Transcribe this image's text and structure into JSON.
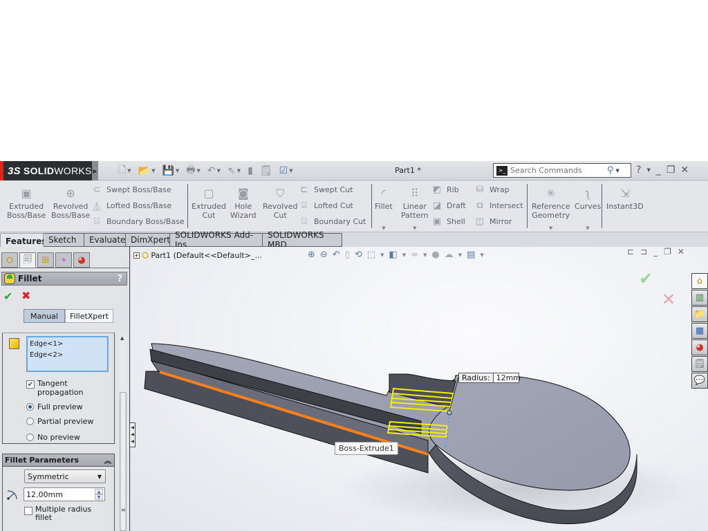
{
  "app": {
    "brand": "SOLIDWORKS",
    "brand_prefix": "3S",
    "brand_solid": "SOLID",
    "brand_works": "WORKS",
    "document_title": "Part1 *",
    "accent_color": "#d9261c"
  },
  "quick_access": [
    {
      "icon": "new-document-icon",
      "glyph": "🗋"
    },
    {
      "icon": "open-folder-icon",
      "glyph": "📂"
    },
    {
      "icon": "save-icon",
      "glyph": "💾"
    },
    {
      "icon": "print-icon",
      "glyph": "🖶"
    },
    {
      "icon": "undo-icon",
      "glyph": "↶"
    },
    {
      "icon": "select-pointer-icon",
      "glyph": "⇖"
    },
    {
      "icon": "rebuild-icon",
      "glyph": "▮"
    },
    {
      "icon": "file-properties-icon",
      "glyph": "🗒"
    },
    {
      "icon": "options-icon",
      "glyph": "☑"
    }
  ],
  "search": {
    "placeholder": "Search Commands"
  },
  "window_controls": {
    "help": "?",
    "minimize": "_",
    "restore": "❐",
    "close": "✕"
  },
  "ribbon": {
    "extruded_boss": "Extruded\nBoss/Base",
    "revolved_boss": "Revolved\nBoss/Base",
    "swept_boss": "Swept Boss/Base",
    "lofted_boss": "Lofted Boss/Base",
    "boundary_boss": "Boundary Boss/Base",
    "extruded_cut": "Extruded\nCut",
    "hole_wizard": "Hole\nWizard",
    "revolved_cut": "Revolved\nCut",
    "swept_cut": "Swept Cut",
    "lofted_cut": "Lofted Cut",
    "boundary_cut": "Boundary Cut",
    "fillet": "Fillet",
    "linear_pattern": "Linear\nPattern",
    "rib": "Rib",
    "draft": "Draft",
    "shell": "Shell",
    "wrap": "Wrap",
    "intersect": "Intersect",
    "mirror": "Mirror",
    "reference_geometry": "Reference\nGeometry",
    "curves": "Curves",
    "instant3d": "Instant3D"
  },
  "command_tabs": [
    {
      "label": "Features",
      "active": true
    },
    {
      "label": "Sketch",
      "active": false
    },
    {
      "label": "Evaluate",
      "active": false
    },
    {
      "label": "DimXpert",
      "active": false
    },
    {
      "label": "SOLIDWORKS Add-Ins",
      "active": false
    },
    {
      "label": "SOLIDWORKS MBD",
      "active": false
    }
  ],
  "manager_tabs": [
    {
      "icon": "feature-manager-icon",
      "glyph": "⛭"
    },
    {
      "icon": "property-manager-icon",
      "glyph": "🗐"
    },
    {
      "icon": "configuration-manager-icon",
      "glyph": "⊞"
    },
    {
      "icon": "dimxpert-manager-icon",
      "glyph": "⌖"
    },
    {
      "icon": "display-manager-icon",
      "glyph": "◕"
    }
  ],
  "property_manager": {
    "title": "Fillet",
    "help": "?",
    "modes": [
      "Manual",
      "FilletXpert"
    ],
    "active_mode": "Manual",
    "selected_items": [
      "Edge<1>",
      "Edge<2>"
    ],
    "tangent_propagation": {
      "label_line1": "Tangent",
      "label_line2": "propagation",
      "checked": true
    },
    "preview_options": [
      {
        "label": "Full preview",
        "selected": true
      },
      {
        "label": "Partial preview",
        "selected": false
      },
      {
        "label": "No preview",
        "selected": false
      }
    ],
    "fillet_parameters": {
      "header": "Fillet Parameters",
      "type": "Symmetric",
      "radius": "12.00mm",
      "multiple_radius": {
        "label_line1": "Multiple radius",
        "label_line2": "fillet",
        "checked": false
      }
    }
  },
  "graphics": {
    "tree_root": "Part1  (Default<<Default>_...",
    "radius_callout_label": "Radius:",
    "radius_callout_value": "12mm",
    "feature_tooltip": "Boss-Extrude1",
    "selection_color": "#ff7f1a",
    "preview_color": "#f4f000"
  },
  "heads_up_toolbar": [
    {
      "icon": "zoom-to-fit-icon",
      "glyph": "🔍"
    },
    {
      "icon": "zoom-to-area-icon",
      "glyph": "🔎"
    },
    {
      "icon": "previous-view-icon",
      "glyph": "↶"
    },
    {
      "icon": "section-view-icon",
      "glyph": "▯"
    },
    {
      "icon": "dynamic-annotation-icon",
      "glyph": "⟲"
    },
    {
      "icon": "view-orientation-icon",
      "glyph": "⬚"
    },
    {
      "icon": "display-style-icon",
      "glyph": "◧"
    },
    {
      "icon": "hide-show-items-icon",
      "glyph": "👓"
    },
    {
      "icon": "edit-appearance-icon",
      "glyph": "●"
    },
    {
      "icon": "apply-scene-icon",
      "glyph": "☁"
    },
    {
      "icon": "view-settings-icon",
      "glyph": "🖥"
    }
  ],
  "task_pane": [
    {
      "icon": "solidworks-resources-icon",
      "glyph": "⌂"
    },
    {
      "icon": "design-library-icon",
      "glyph": "📚"
    },
    {
      "icon": "file-explorer-icon",
      "glyph": "📁"
    },
    {
      "icon": "view-palette-icon",
      "glyph": "▦"
    },
    {
      "icon": "appearances-icon",
      "glyph": "◕"
    },
    {
      "icon": "custom-properties-icon",
      "glyph": "🗒"
    },
    {
      "icon": "forum-icon",
      "glyph": "💬"
    }
  ]
}
